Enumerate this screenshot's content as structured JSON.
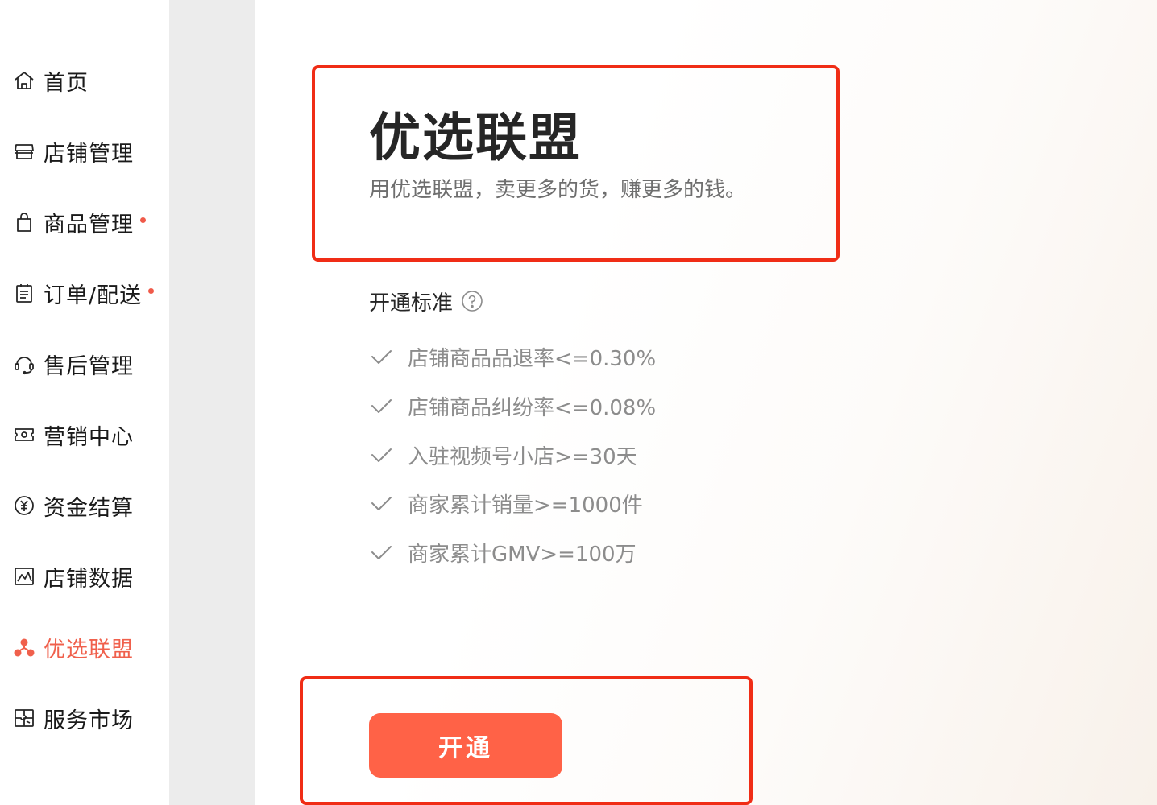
{
  "sidebar": {
    "items": [
      {
        "label": "首页",
        "icon": "home-icon",
        "dot": false,
        "active": false
      },
      {
        "label": "店铺管理",
        "icon": "store-icon",
        "dot": false,
        "active": false
      },
      {
        "label": "商品管理",
        "icon": "shopping-bag-icon",
        "dot": true,
        "active": false
      },
      {
        "label": "订单/配送",
        "icon": "clipboard-icon",
        "dot": true,
        "active": false
      },
      {
        "label": "售后管理",
        "icon": "headset-icon",
        "dot": false,
        "active": false
      },
      {
        "label": "营销中心",
        "icon": "ticket-icon",
        "dot": false,
        "active": false
      },
      {
        "label": "资金结算",
        "icon": "yuan-coin-icon",
        "dot": false,
        "active": false
      },
      {
        "label": "店铺数据",
        "icon": "chart-icon",
        "dot": false,
        "active": false
      },
      {
        "label": "优选联盟",
        "icon": "alliance-icon",
        "dot": false,
        "active": true
      },
      {
        "label": "服务市场",
        "icon": "puzzle-icon",
        "dot": false,
        "active": false
      }
    ],
    "active_color": "#f0604c",
    "dot_color": "#f05a4a"
  },
  "main": {
    "title": "优选联盟",
    "subtitle": "用优选联盟，卖更多的货，赚更多的钱。",
    "criteria_title": "开通标准",
    "criteria": [
      "店铺商品品退率<=0.30%",
      "店铺商品纠纷率<=0.08%",
      "入驻视频号小店>=30天",
      "商家累计销量>=1000件",
      "商家累计GMV>=100万"
    ],
    "open_button": "开通",
    "button_color": "#ff6247",
    "highlight_color": "#f02d16"
  }
}
